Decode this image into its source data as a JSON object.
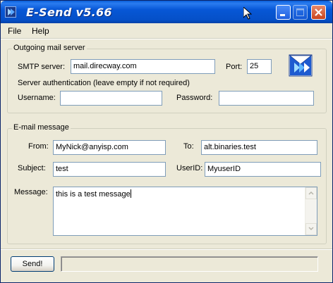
{
  "window": {
    "title": "E-Send v5.66"
  },
  "menu": {
    "file": "File",
    "help": "Help"
  },
  "outgoing": {
    "group_title": "Outgoing mail server",
    "smtp_label": "SMTP server:",
    "smtp_value": "mail.direcway.com",
    "port_label": "Port:",
    "port_value": "25",
    "auth_note": "Server authentication (leave empty if not required)",
    "username_label": "Username:",
    "username_value": "",
    "password_label": "Password:",
    "password_value": ""
  },
  "email": {
    "group_title": "E-mail message",
    "from_label": "From:",
    "from_value": "MyNick@anyisp.com",
    "to_label": "To:",
    "to_value": "alt.binaries.test",
    "subject_label": "Subject:",
    "subject_value": "test",
    "userid_label": "UserID:",
    "userid_value": "MyuserID",
    "message_label": "Message:",
    "message_value": "this is a test message"
  },
  "footer": {
    "send_label": "Send!",
    "status_text": ""
  },
  "icons": {
    "app": "app-icon",
    "send": "send-mail-icon",
    "minimize": "minimize-icon",
    "maximize": "maximize-icon",
    "close": "close-icon"
  },
  "colors": {
    "titlebar": "#0757d6",
    "window_bg": "#ece9d8",
    "field_border": "#7f9db9",
    "close": "#c9441e"
  }
}
